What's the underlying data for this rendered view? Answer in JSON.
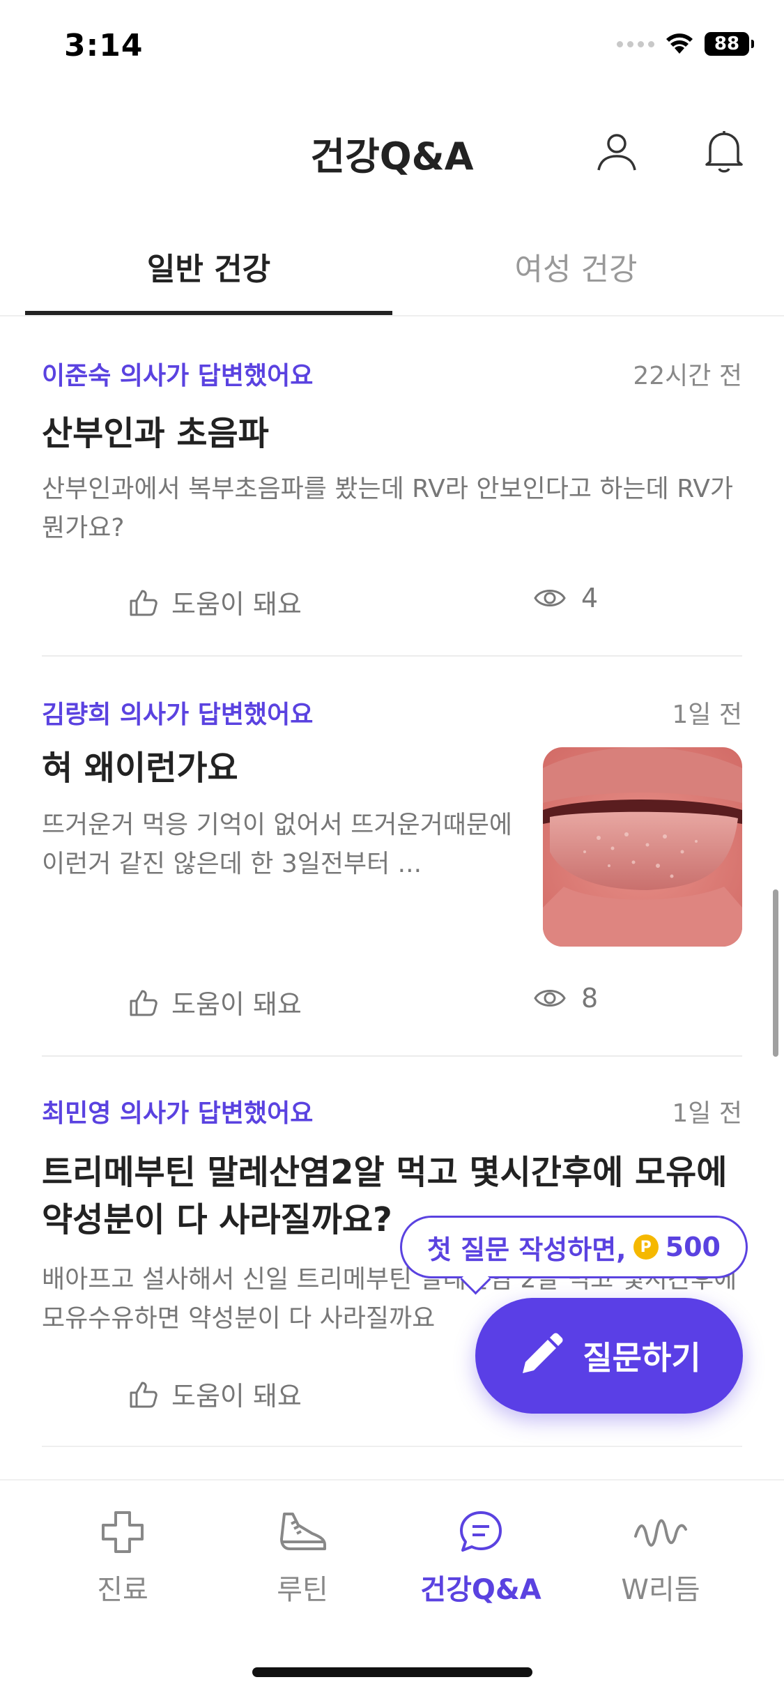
{
  "status_bar": {
    "time": "3:14",
    "battery": "88"
  },
  "header": {
    "title": "건강Q&A"
  },
  "tabs": [
    {
      "label": "일반 건강",
      "active": true
    },
    {
      "label": "여성 건강",
      "active": false
    }
  ],
  "posts": [
    {
      "doctor": "이준숙 의사가 답변했어요",
      "time": "22시간 전",
      "title": "산부인과 초음파",
      "body": "산부인과에서 복부초음파를 봤는데 RV라 안보인다고 하는데 RV가 뭔가요?",
      "helpful_label": "도움이 돼요",
      "views": "4"
    },
    {
      "doctor": "김량희 의사가 답변했어요",
      "time": "1일 전",
      "title": "혀 왜이런가요",
      "body": "뜨거운거 먹응 기억이 없어서 뜨거운거때문에 이런거 같진 않은데 한 3일전부터 ...",
      "helpful_label": "도움이 돼요",
      "views": "8"
    },
    {
      "doctor": "최민영 의사가 답변했어요",
      "time": "1일 전",
      "title": "트리메부틴 말레산염2알 먹고 몇시간후에 모유에 약성분이 다 사라질까요?",
      "body": "배아프고 설사해서 신일 트리메부틴 말레산염 2알 먹고 몇시간후에 모유수유하면 약성분이 다 사라질까요",
      "helpful_label": "도움이 돼요"
    }
  ],
  "promo_bubble": {
    "text": "첫 질문 작성하면,",
    "coin_symbol": "P",
    "points": "500"
  },
  "fab": {
    "label": "질문하기"
  },
  "bottom_nav": [
    {
      "label": "진료",
      "icon": "cross-icon"
    },
    {
      "label": "루틴",
      "icon": "sneaker-icon"
    },
    {
      "label": "건강Q&A",
      "icon": "chat-bubble-icon",
      "active": true
    },
    {
      "label": "W리듬",
      "icon": "wave-icon"
    }
  ],
  "colors": {
    "accent": "#5a42e0",
    "fab": "#5a3fe6",
    "coin": "#f5b800"
  }
}
